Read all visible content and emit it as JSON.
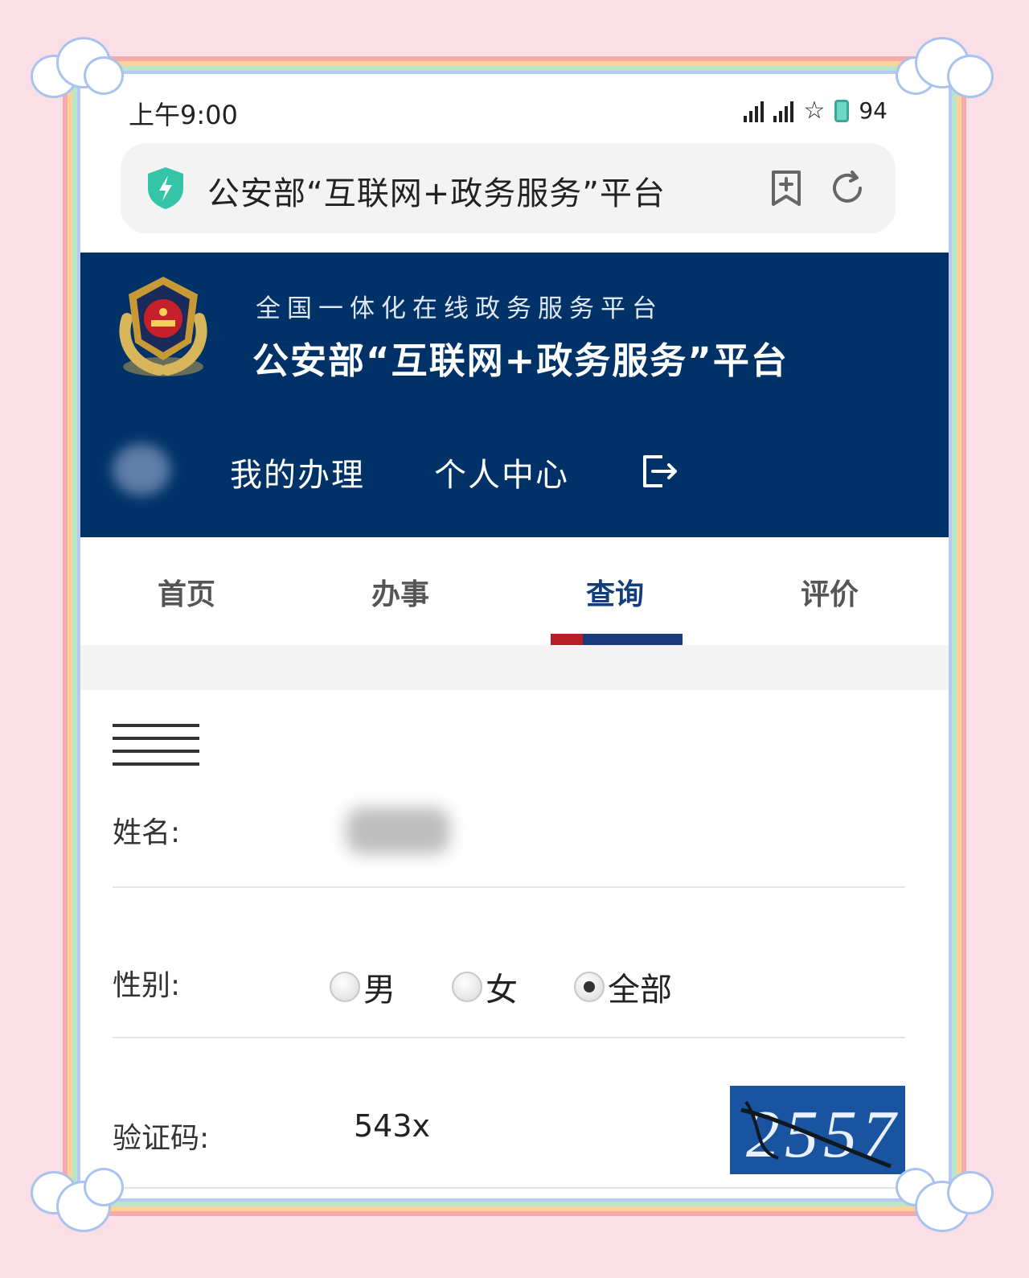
{
  "status_bar": {
    "time": "上午9:00",
    "battery": "94"
  },
  "address_bar": {
    "title": "公安部“互联网+政务服务”平台",
    "shield_icon": "shield-bolt-icon",
    "bookmark_icon": "add-bookmark-icon",
    "refresh_icon": "refresh-icon"
  },
  "header": {
    "subtitle": "全国一体化在线政务服务平台",
    "title": "公安部“互联网+政务服务”平台",
    "nav": {
      "my_handling": "我的办理",
      "personal_center": "个人中心"
    }
  },
  "tabs": [
    {
      "label": "首页",
      "active": false
    },
    {
      "label": "办事",
      "active": false
    },
    {
      "label": "查询",
      "active": true
    },
    {
      "label": "评价",
      "active": false
    }
  ],
  "form": {
    "name_label": "姓名:",
    "gender_label": "性别:",
    "gender_options": [
      {
        "label": "男",
        "checked": false
      },
      {
        "label": "女",
        "checked": false
      },
      {
        "label": "全部",
        "checked": true
      }
    ],
    "captcha_label": "验证码:",
    "captcha_value": "543x",
    "captcha_image_text": "2557"
  },
  "colors": {
    "header_bg": "#003268",
    "accent_blue": "#123e7b",
    "accent_red": "#b81d2a"
  }
}
